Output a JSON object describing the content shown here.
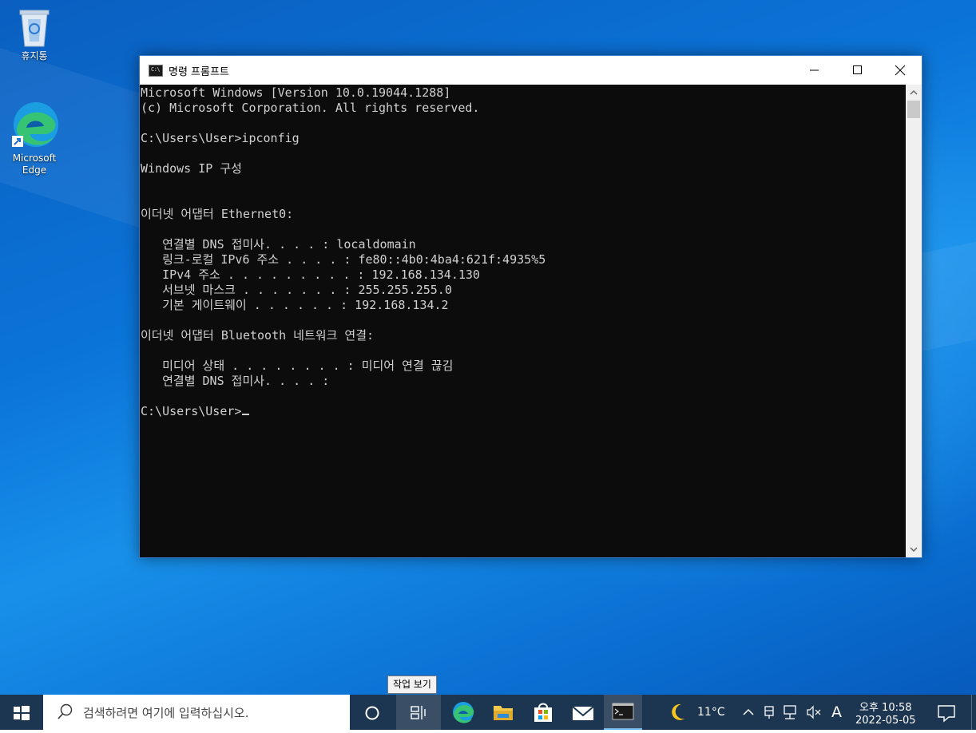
{
  "desktop": {
    "icons": [
      {
        "label": "휴지통",
        "icon": "recycle-bin-icon"
      },
      {
        "label": "Microsoft Edge",
        "icon": "edge-icon"
      }
    ]
  },
  "window": {
    "title": "명령 프롬프트",
    "icon": "cmd-icon",
    "icon_text": "C:\\",
    "buttons": [
      "minimize-icon",
      "maximize-icon",
      "close-icon"
    ]
  },
  "console": {
    "lines": [
      "Microsoft Windows [Version 10.0.19044.1288]",
      "(c) Microsoft Corporation. All rights reserved.",
      "",
      "C:\\Users\\User>ipconfig",
      "",
      "Windows IP 구성",
      "",
      "",
      "이더넷 어댑터 Ethernet0:",
      "",
      "   연결별 DNS 접미사. . . . : localdomain",
      "   링크-로컬 IPv6 주소 . . . . : fe80::4b0:4ba4:621f:4935%5",
      "   IPv4 주소 . . . . . . . . . : 192.168.134.130",
      "   서브넷 마스크 . . . . . . . : 255.255.255.0",
      "   기본 게이트웨이 . . . . . . : 192.168.134.2",
      "",
      "이더넷 어댑터 Bluetooth 네트워크 연결:",
      "",
      "   미디어 상태 . . . . . . . . : 미디어 연결 끊김",
      "   연결별 DNS 접미사. . . . :",
      "",
      "C:\\Users\\User>"
    ]
  },
  "tooltip": {
    "text": "작업 보기"
  },
  "taskbar": {
    "start_icon": "windows-logo-icon",
    "search_placeholder": "검색하려면 여기에 입력하십시오.",
    "pinned": [
      "cortana-icon",
      "task-view-icon",
      "edge-icon",
      "file-explorer-icon",
      "store-icon",
      "mail-icon",
      "cmd-icon"
    ],
    "weather_icon": "moon-icon",
    "temperature": "11°C",
    "tray_icons": [
      "chevron-up-icon",
      "ime-icon",
      "network-icon",
      "volume-muted-icon"
    ],
    "ime_mode": "A",
    "time": "오후 10:58",
    "date": "2022-05-05",
    "notification_icon": "notification-icon",
    "colors": {
      "bar": "#1c3550",
      "accent": "#0b74d8"
    }
  }
}
